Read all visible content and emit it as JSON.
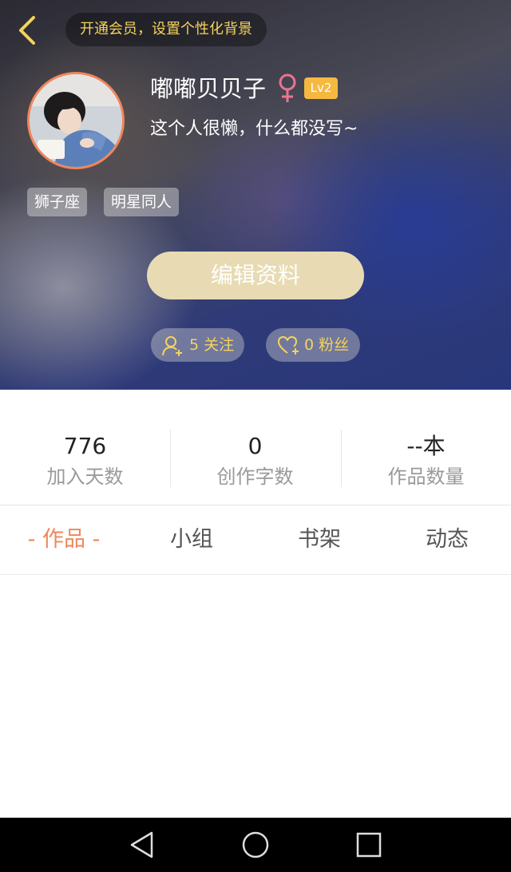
{
  "header": {
    "vip_promo": "开通会员，设置个性化背景"
  },
  "profile": {
    "username": "嘟嘟贝贝子",
    "gender_icon": "female-icon",
    "level_badge": "Lv2",
    "bio": "这个人很懒，什么都没写~",
    "tags": [
      "狮子座",
      "明星同人"
    ],
    "edit_button": "编辑资料",
    "follow_label": "5 关注",
    "fans_label": "0 粉丝"
  },
  "stats": [
    {
      "value": "776",
      "label": "加入天数"
    },
    {
      "value": "0",
      "label": "创作字数"
    },
    {
      "value": "--本",
      "label": "作品数量"
    }
  ],
  "tabs": [
    {
      "label": "- 作品 -",
      "active": true
    },
    {
      "label": "小组",
      "active": false
    },
    {
      "label": "书架",
      "active": false
    },
    {
      "label": "动态",
      "active": false
    }
  ],
  "colors": {
    "accent_orange": "#f0865a",
    "gold_text": "#f5d35a",
    "edit_button_bg": "#e8dbb3",
    "level_badge_bg": "#f5b942",
    "female_pink": "#e9758f"
  }
}
